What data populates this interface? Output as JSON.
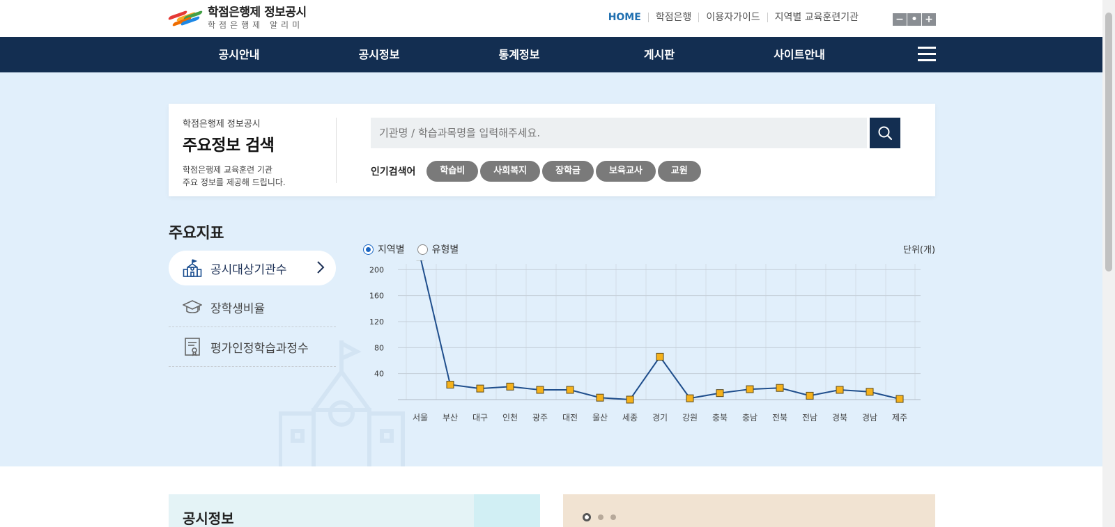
{
  "header": {
    "logo_title": "학점은행제 정보공시",
    "logo_sub": "학점은행제 알리미",
    "util_links": [
      "HOME",
      "학점은행",
      "이용자가이드",
      "지역별 교육훈련기관"
    ],
    "zoom": [
      "−",
      "•",
      "+"
    ]
  },
  "gnb": [
    "공시안내",
    "공시정보",
    "통계정보",
    "게시판",
    "사이트안내"
  ],
  "search": {
    "eyebrow": "학점은행제 정보공시",
    "title": "주요정보 검색",
    "desc1": "학점은행제 교육훈련 기관",
    "desc2": "주요 정보를 제공해 드립니다.",
    "placeholder": "기관명 / 학습과목명을 입력해주세요.",
    "popular_label": "인기검색어",
    "tags": [
      "학습비",
      "사회복지",
      "장학금",
      "보육교사",
      "교원"
    ]
  },
  "indicators": {
    "title": "주요지표",
    "items": [
      "공시대상기관수",
      "장학생비율",
      "평가인정학습과정수"
    ],
    "radio_region": "지역별",
    "radio_type": "유형별",
    "unit": "단위(개)"
  },
  "chart_data": {
    "type": "line",
    "categories": [
      "서울",
      "부산",
      "대구",
      "인천",
      "광주",
      "대전",
      "울산",
      "세종",
      "경기",
      "강원",
      "충북",
      "충남",
      "전북",
      "전남",
      "경북",
      "경남",
      "제주"
    ],
    "values": [
      220,
      23,
      17,
      20,
      15,
      15,
      3,
      0,
      66,
      2,
      10,
      16,
      18,
      6,
      15,
      12,
      1
    ],
    "yticks": [
      40,
      80,
      120,
      160,
      200
    ],
    "ylim": [
      0,
      240
    ],
    "grid": true,
    "colors": {
      "line": "#1f4e8c",
      "marker": "#f5b21c"
    }
  },
  "bottom": {
    "left_title": "공시정보"
  },
  "colors": {
    "navy": "#132e51",
    "hero_bg": "#e1effb",
    "accent": "#1f6fb0"
  }
}
